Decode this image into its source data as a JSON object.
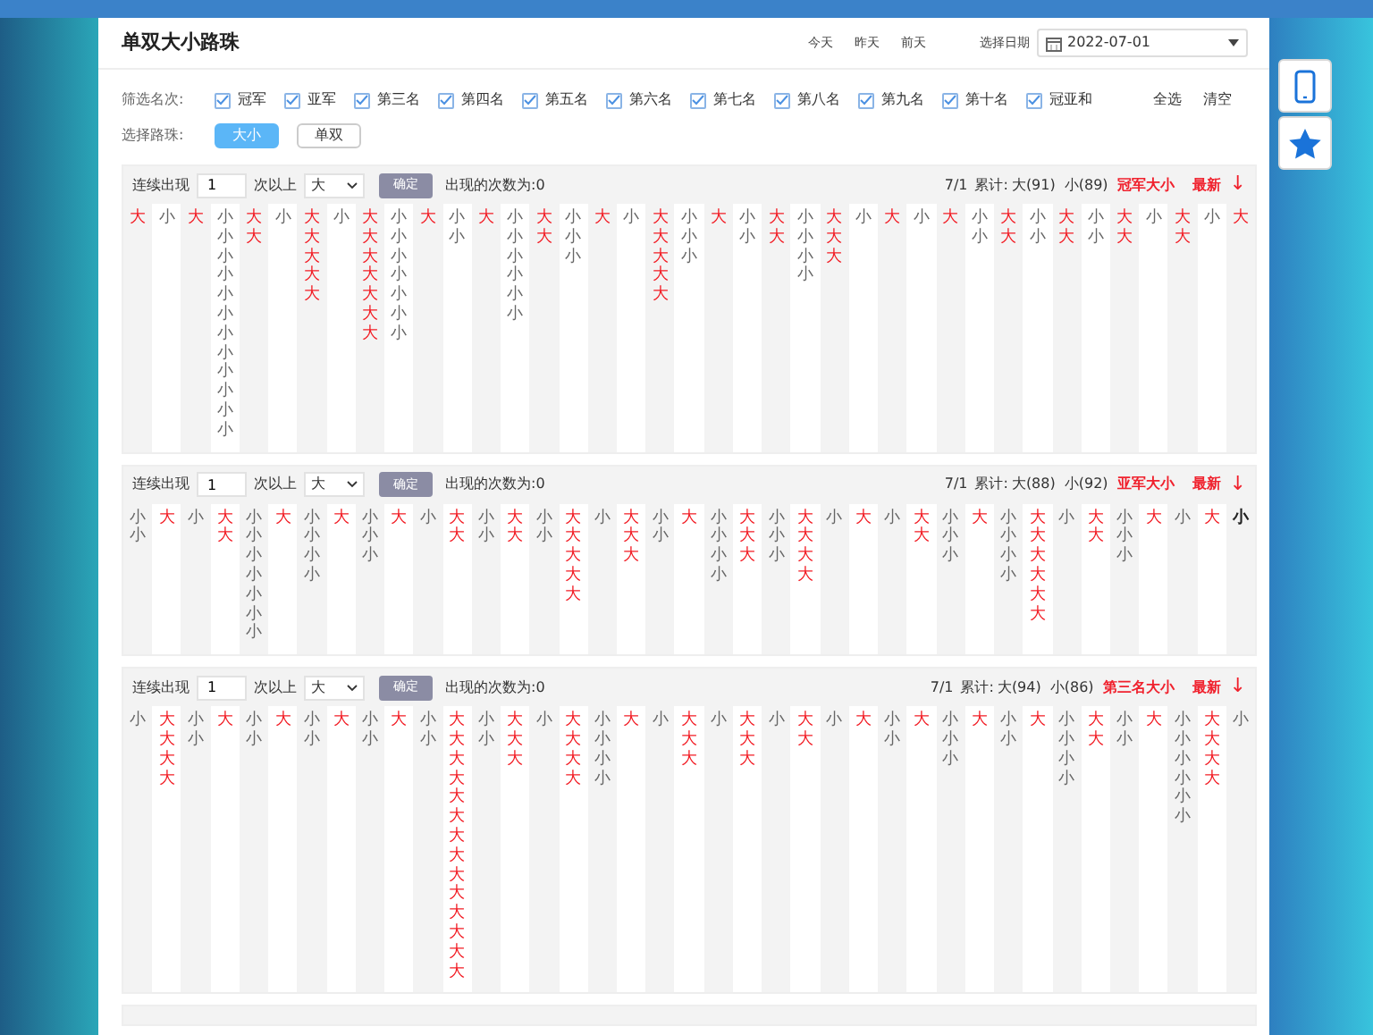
{
  "header": {
    "title": "单双大小路珠",
    "quick_dates": [
      "今天",
      "昨天",
      "前天"
    ],
    "date_label": "选择日期",
    "date_value": "2022-07-01"
  },
  "filter": {
    "label": "筛选名次:",
    "items": [
      {
        "label": "冠军",
        "checked": true
      },
      {
        "label": "亚军",
        "checked": true
      },
      {
        "label": "第三名",
        "checked": true
      },
      {
        "label": "第四名",
        "checked": true
      },
      {
        "label": "第五名",
        "checked": true
      },
      {
        "label": "第六名",
        "checked": true
      },
      {
        "label": "第七名",
        "checked": true
      },
      {
        "label": "第八名",
        "checked": true
      },
      {
        "label": "第九名",
        "checked": true
      },
      {
        "label": "第十名",
        "checked": true
      },
      {
        "label": "冠亚和",
        "checked": true
      }
    ],
    "actions": [
      "全选",
      "清空"
    ]
  },
  "road_type": {
    "label": "选择路珠:",
    "options": [
      {
        "label": "大小",
        "selected": true
      },
      {
        "label": "单双",
        "selected": false
      }
    ]
  },
  "panels": [
    {
      "streak_label": "连续出现",
      "streak_value": "1",
      "streak_suffix": "次以上",
      "select_value": "大",
      "confirm": "确定",
      "result": "出现的次数为:0",
      "date": "7/1",
      "total_label": "累计:",
      "big_total": "大(91)",
      "small_total": "小(89)",
      "name": "冠军大小",
      "latest": "最新",
      "arrow": "↓",
      "last_highlighted": false,
      "columns": [
        {
          "kind": "big",
          "cells": [
            "大"
          ]
        },
        {
          "kind": "small",
          "cells": [
            "小"
          ]
        },
        {
          "kind": "big",
          "cells": [
            "大"
          ]
        },
        {
          "kind": "small",
          "cells": [
            "小",
            "小",
            "小",
            "小",
            "小",
            "小",
            "小",
            "小",
            "小",
            "小",
            "小",
            "小"
          ]
        },
        {
          "kind": "big",
          "cells": [
            "大",
            "大"
          ]
        },
        {
          "kind": "small",
          "cells": [
            "小"
          ]
        },
        {
          "kind": "big",
          "cells": [
            "大",
            "大",
            "大",
            "大",
            "大"
          ]
        },
        {
          "kind": "small",
          "cells": [
            "小"
          ]
        },
        {
          "kind": "big",
          "cells": [
            "大",
            "大",
            "大",
            "大",
            "大",
            "大",
            "大"
          ]
        },
        {
          "kind": "small",
          "cells": [
            "小",
            "小",
            "小",
            "小",
            "小",
            "小",
            "小"
          ]
        },
        {
          "kind": "big",
          "cells": [
            "大"
          ]
        },
        {
          "kind": "small",
          "cells": [
            "小",
            "小"
          ]
        },
        {
          "kind": "big",
          "cells": [
            "大"
          ]
        },
        {
          "kind": "small",
          "cells": [
            "小",
            "小",
            "小",
            "小",
            "小",
            "小"
          ]
        },
        {
          "kind": "big",
          "cells": [
            "大",
            "大"
          ]
        },
        {
          "kind": "small",
          "cells": [
            "小",
            "小",
            "小"
          ]
        },
        {
          "kind": "big",
          "cells": [
            "大"
          ]
        },
        {
          "kind": "small",
          "cells": [
            "小"
          ]
        },
        {
          "kind": "big",
          "cells": [
            "大",
            "大",
            "大",
            "大",
            "大"
          ]
        },
        {
          "kind": "small",
          "cells": [
            "小",
            "小",
            "小"
          ]
        },
        {
          "kind": "big",
          "cells": [
            "大"
          ]
        },
        {
          "kind": "small",
          "cells": [
            "小",
            "小"
          ]
        },
        {
          "kind": "big",
          "cells": [
            "大",
            "大"
          ]
        },
        {
          "kind": "small",
          "cells": [
            "小",
            "小",
            "小",
            "小"
          ]
        },
        {
          "kind": "big",
          "cells": [
            "大",
            "大",
            "大"
          ]
        },
        {
          "kind": "small",
          "cells": [
            "小"
          ]
        },
        {
          "kind": "big",
          "cells": [
            "大"
          ]
        },
        {
          "kind": "small",
          "cells": [
            "小"
          ]
        },
        {
          "kind": "big",
          "cells": [
            "大"
          ]
        },
        {
          "kind": "small",
          "cells": [
            "小",
            "小"
          ]
        },
        {
          "kind": "big",
          "cells": [
            "大",
            "大"
          ]
        },
        {
          "kind": "small",
          "cells": [
            "小",
            "小"
          ]
        },
        {
          "kind": "big",
          "cells": [
            "大",
            "大"
          ]
        },
        {
          "kind": "small",
          "cells": [
            "小",
            "小"
          ]
        },
        {
          "kind": "big",
          "cells": [
            "大",
            "大"
          ]
        },
        {
          "kind": "small",
          "cells": [
            "小"
          ]
        },
        {
          "kind": "big",
          "cells": [
            "大",
            "大"
          ]
        },
        {
          "kind": "small",
          "cells": [
            "小"
          ]
        },
        {
          "kind": "big",
          "cells": [
            "大"
          ]
        }
      ]
    },
    {
      "streak_label": "连续出现",
      "streak_value": "1",
      "streak_suffix": "次以上",
      "select_value": "大",
      "confirm": "确定",
      "result": "出现的次数为:0",
      "date": "7/1",
      "total_label": "累计:",
      "big_total": "大(88)",
      "small_total": "小(92)",
      "name": "亚军大小",
      "latest": "最新",
      "arrow": "↓",
      "last_highlighted": true,
      "columns": [
        {
          "kind": "small",
          "cells": [
            "小",
            "小"
          ]
        },
        {
          "kind": "big",
          "cells": [
            "大"
          ]
        },
        {
          "kind": "small",
          "cells": [
            "小"
          ]
        },
        {
          "kind": "big",
          "cells": [
            "大",
            "大"
          ]
        },
        {
          "kind": "small",
          "cells": [
            "小",
            "小",
            "小",
            "小",
            "小",
            "小",
            "小"
          ]
        },
        {
          "kind": "big",
          "cells": [
            "大"
          ]
        },
        {
          "kind": "small",
          "cells": [
            "小",
            "小",
            "小",
            "小"
          ]
        },
        {
          "kind": "big",
          "cells": [
            "大"
          ]
        },
        {
          "kind": "small",
          "cells": [
            "小",
            "小",
            "小"
          ]
        },
        {
          "kind": "big",
          "cells": [
            "大"
          ]
        },
        {
          "kind": "small",
          "cells": [
            "小"
          ]
        },
        {
          "kind": "big",
          "cells": [
            "大",
            "大"
          ]
        },
        {
          "kind": "small",
          "cells": [
            "小",
            "小"
          ]
        },
        {
          "kind": "big",
          "cells": [
            "大",
            "大"
          ]
        },
        {
          "kind": "small",
          "cells": [
            "小",
            "小"
          ]
        },
        {
          "kind": "big",
          "cells": [
            "大",
            "大",
            "大",
            "大",
            "大"
          ]
        },
        {
          "kind": "small",
          "cells": [
            "小"
          ]
        },
        {
          "kind": "big",
          "cells": [
            "大",
            "大",
            "大"
          ]
        },
        {
          "kind": "small",
          "cells": [
            "小",
            "小"
          ]
        },
        {
          "kind": "big",
          "cells": [
            "大"
          ]
        },
        {
          "kind": "small",
          "cells": [
            "小",
            "小",
            "小",
            "小"
          ]
        },
        {
          "kind": "big",
          "cells": [
            "大",
            "大",
            "大"
          ]
        },
        {
          "kind": "small",
          "cells": [
            "小",
            "小",
            "小"
          ]
        },
        {
          "kind": "big",
          "cells": [
            "大",
            "大",
            "大",
            "大"
          ]
        },
        {
          "kind": "small",
          "cells": [
            "小"
          ]
        },
        {
          "kind": "big",
          "cells": [
            "大"
          ]
        },
        {
          "kind": "small",
          "cells": [
            "小"
          ]
        },
        {
          "kind": "big",
          "cells": [
            "大",
            "大"
          ]
        },
        {
          "kind": "small",
          "cells": [
            "小",
            "小",
            "小"
          ]
        },
        {
          "kind": "big",
          "cells": [
            "大"
          ]
        },
        {
          "kind": "small",
          "cells": [
            "小",
            "小",
            "小",
            "小"
          ]
        },
        {
          "kind": "big",
          "cells": [
            "大",
            "大",
            "大",
            "大",
            "大",
            "大"
          ]
        },
        {
          "kind": "small",
          "cells": [
            "小"
          ]
        },
        {
          "kind": "big",
          "cells": [
            "大",
            "大"
          ]
        },
        {
          "kind": "small",
          "cells": [
            "小",
            "小",
            "小"
          ]
        },
        {
          "kind": "big",
          "cells": [
            "大"
          ]
        },
        {
          "kind": "small",
          "cells": [
            "小"
          ]
        },
        {
          "kind": "big",
          "cells": [
            "大"
          ]
        },
        {
          "kind": "small",
          "cells": [
            "小"
          ]
        }
      ]
    },
    {
      "streak_label": "连续出现",
      "streak_value": "1",
      "streak_suffix": "次以上",
      "select_value": "大",
      "confirm": "确定",
      "result": "出现的次数为:0",
      "date": "7/1",
      "total_label": "累计:",
      "big_total": "大(94)",
      "small_total": "小(86)",
      "name": "第三名大小",
      "latest": "最新",
      "arrow": "↓",
      "last_highlighted": false,
      "columns": [
        {
          "kind": "small",
          "cells": [
            "小"
          ]
        },
        {
          "kind": "big",
          "cells": [
            "大",
            "大",
            "大",
            "大"
          ]
        },
        {
          "kind": "small",
          "cells": [
            "小",
            "小"
          ]
        },
        {
          "kind": "big",
          "cells": [
            "大"
          ]
        },
        {
          "kind": "small",
          "cells": [
            "小",
            "小"
          ]
        },
        {
          "kind": "big",
          "cells": [
            "大"
          ]
        },
        {
          "kind": "small",
          "cells": [
            "小",
            "小"
          ]
        },
        {
          "kind": "big",
          "cells": [
            "大"
          ]
        },
        {
          "kind": "small",
          "cells": [
            "小",
            "小"
          ]
        },
        {
          "kind": "big",
          "cells": [
            "大"
          ]
        },
        {
          "kind": "small",
          "cells": [
            "小",
            "小"
          ]
        },
        {
          "kind": "big",
          "cells": [
            "大",
            "大",
            "大",
            "大",
            "大",
            "大",
            "大",
            "大",
            "大",
            "大",
            "大",
            "大",
            "大",
            "大"
          ]
        },
        {
          "kind": "small",
          "cells": [
            "小",
            "小"
          ]
        },
        {
          "kind": "big",
          "cells": [
            "大",
            "大",
            "大"
          ]
        },
        {
          "kind": "small",
          "cells": [
            "小"
          ]
        },
        {
          "kind": "big",
          "cells": [
            "大",
            "大",
            "大",
            "大"
          ]
        },
        {
          "kind": "small",
          "cells": [
            "小",
            "小",
            "小",
            "小"
          ]
        },
        {
          "kind": "big",
          "cells": [
            "大"
          ]
        },
        {
          "kind": "small",
          "cells": [
            "小"
          ]
        },
        {
          "kind": "big",
          "cells": [
            "大",
            "大",
            "大"
          ]
        },
        {
          "kind": "small",
          "cells": [
            "小"
          ]
        },
        {
          "kind": "big",
          "cells": [
            "大",
            "大",
            "大"
          ]
        },
        {
          "kind": "small",
          "cells": [
            "小"
          ]
        },
        {
          "kind": "big",
          "cells": [
            "大",
            "大"
          ]
        },
        {
          "kind": "small",
          "cells": [
            "小"
          ]
        },
        {
          "kind": "big",
          "cells": [
            "大"
          ]
        },
        {
          "kind": "small",
          "cells": [
            "小",
            "小"
          ]
        },
        {
          "kind": "big",
          "cells": [
            "大"
          ]
        },
        {
          "kind": "small",
          "cells": [
            "小",
            "小",
            "小"
          ]
        },
        {
          "kind": "big",
          "cells": [
            "大"
          ]
        },
        {
          "kind": "small",
          "cells": [
            "小",
            "小"
          ]
        },
        {
          "kind": "big",
          "cells": [
            "大"
          ]
        },
        {
          "kind": "small",
          "cells": [
            "小",
            "小",
            "小",
            "小"
          ]
        },
        {
          "kind": "big",
          "cells": [
            "大",
            "大"
          ]
        },
        {
          "kind": "small",
          "cells": [
            "小",
            "小"
          ]
        },
        {
          "kind": "big",
          "cells": [
            "大"
          ]
        },
        {
          "kind": "small",
          "cells": [
            "小",
            "小",
            "小",
            "小",
            "小",
            "小"
          ]
        },
        {
          "kind": "big",
          "cells": [
            "大",
            "大",
            "大",
            "大"
          ]
        },
        {
          "kind": "small",
          "cells": [
            "小"
          ]
        }
      ]
    }
  ]
}
